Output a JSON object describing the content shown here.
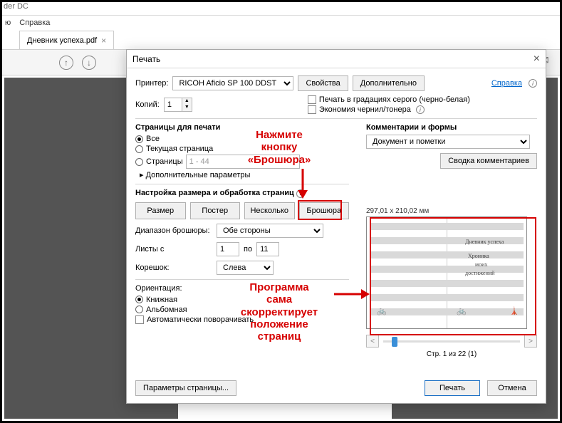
{
  "app": {
    "title_suffix": "der DC"
  },
  "menu": {
    "item1": "ю",
    "item2": "Справка"
  },
  "tab": {
    "name": "Дневник успеха.pdf"
  },
  "dialog": {
    "title": "Печать",
    "printer_lbl": "Принтер:",
    "printer_val": "RICOH Aficio SP 100 DDST",
    "properties_btn": "Свойства",
    "advanced_btn": "Дополнительно",
    "help_link": "Справка",
    "copies_lbl": "Копий:",
    "copies_val": "1",
    "chk_gray": "Печать в градациях серого (черно-белая)",
    "chk_ink": "Экономия чернил/тонера",
    "pages_group": "Страницы для печати",
    "rad_all": "Все",
    "rad_current": "Текущая страница",
    "rad_pages": "Страницы",
    "pages_range": "1 - 44",
    "more_params": "Дополнительные параметры",
    "size_group": "Настройка размера и обработка страниц",
    "btn_size": "Размер",
    "btn_poster": "Постер",
    "btn_multi": "Несколько",
    "btn_booklet": "Брошюра",
    "booklet_range_lbl": "Диапазон брошюры:",
    "booklet_range_val": "Обе стороны",
    "sheets_lbl": "Листы с",
    "sheets_from": "1",
    "sheets_to_lbl": "по",
    "sheets_to": "11",
    "binding_lbl": "Корешок:",
    "binding_val": "Слева",
    "orient_group": "Ориентация:",
    "rad_portrait": "Книжная",
    "rad_landscape": "Альбомная",
    "chk_autorotate": "Автоматически поворачивать",
    "comments_group": "Комментарии и формы",
    "comments_val": "Документ и пометки",
    "comments_summary": "Сводка комментариев",
    "preview_dims": "297,01 x 210,02 мм",
    "preview_caption": "Стр. 1 из 22 (1)",
    "page_setup_btn": "Параметры страницы...",
    "print_btn": "Печать",
    "cancel_btn": "Отмена",
    "preview_texts": {
      "t1": "Дневник успеха",
      "t2": "Хроника",
      "t3": "моих",
      "t4": "достижений"
    }
  },
  "annotations": {
    "a1_l1": "Нажмите",
    "a1_l2": "кнопку",
    "a1_l3": "«Брошюра»",
    "a2_l1": "Программа",
    "a2_l2": "сама",
    "a2_l3": "скорректирует",
    "a2_l4": "положение",
    "a2_l5": "страниц"
  }
}
